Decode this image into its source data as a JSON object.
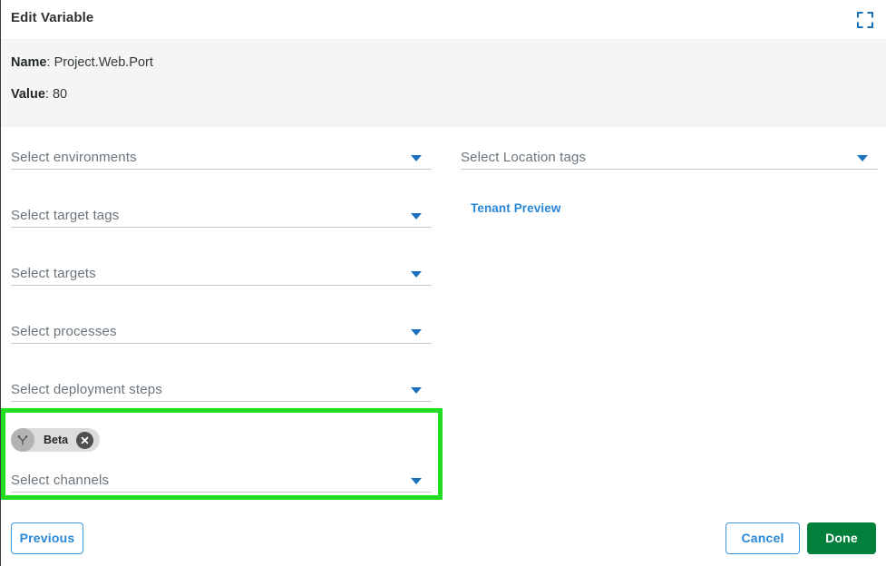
{
  "header": {
    "title": "Edit Variable",
    "expand_icon": "expand-fullscreen-icon"
  },
  "info": {
    "name_label": "Name",
    "name_separator": ": ",
    "name_value": "Project.Web.Port",
    "value_label": "Value",
    "value_separator": ": ",
    "value_value": "80"
  },
  "left_fields": [
    {
      "placeholder": "Select environments",
      "caret_icon": "chevron-down-icon"
    },
    {
      "placeholder": "Select target tags",
      "caret_icon": "chevron-down-icon"
    },
    {
      "placeholder": "Select targets",
      "caret_icon": "chevron-down-icon"
    },
    {
      "placeholder": "Select processes",
      "caret_icon": "chevron-down-icon"
    },
    {
      "placeholder": "Select deployment steps",
      "caret_icon": "chevron-down-icon"
    }
  ],
  "channels_field": {
    "placeholder": "Select channels",
    "caret_icon": "chevron-down-icon",
    "chips": [
      {
        "label": "Beta",
        "avatar_icon": "channel-fork-icon",
        "remove_icon": "close-circle-icon"
      }
    ]
  },
  "right_column": {
    "location_tags": {
      "placeholder": "Select Location tags",
      "caret_icon": "chevron-down-icon"
    },
    "tenant_preview_link": "Tenant Preview"
  },
  "footer": {
    "previous_label": "Previous",
    "cancel_label": "Cancel",
    "done_label": "Done"
  },
  "colors": {
    "accent_blue": "#1b72bd",
    "link_blue": "#2a87d8",
    "done_green": "#00803b",
    "highlight_green": "#22dd22",
    "info_panel_bg": "#f5f5f5",
    "placeholder_gray": "#6a757c"
  }
}
